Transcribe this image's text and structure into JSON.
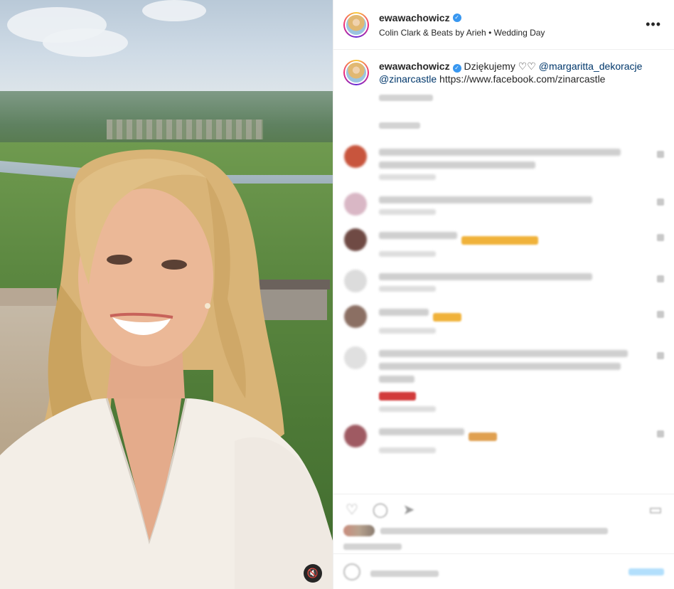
{
  "post": {
    "username": "ewawachowicz",
    "verified": true,
    "audio": "Colin Clark & Beats by Arieh • Wedding Day",
    "more_icon": "more-horizontal-icon"
  },
  "caption": {
    "username": "ewawachowicz",
    "text": "Dziękujemy",
    "hearts": "♡♡",
    "mention_1": "@margaritta_dekoracje",
    "mention_2": "@zinarcastle",
    "url": "https://www.facebook.com/zinarcastle"
  },
  "media": {
    "mute_icon": "speaker-muted-icon",
    "mute_glyph": "🔇"
  },
  "comments": [
    {
      "avatar_color": "#c8553d",
      "lines": 2,
      "emoji": false
    },
    {
      "avatar_color": "#d9b7c5",
      "lines": 1,
      "emoji": false
    },
    {
      "avatar_color": "#6f4a44",
      "lines": 1,
      "emoji": true
    },
    {
      "avatar_color": "#dcdcdc",
      "lines": 1,
      "emoji": false
    },
    {
      "avatar_color": "#8b6f63",
      "lines": 1,
      "emoji": true
    },
    {
      "avatar_color": "#e0e0e0",
      "lines": 3,
      "emoji": true
    },
    {
      "avatar_color": "#9f5a62",
      "lines": 1,
      "emoji": true
    }
  ],
  "colors": {
    "link": "#00376b",
    "verified": "#3897f0",
    "text": "#262626"
  }
}
